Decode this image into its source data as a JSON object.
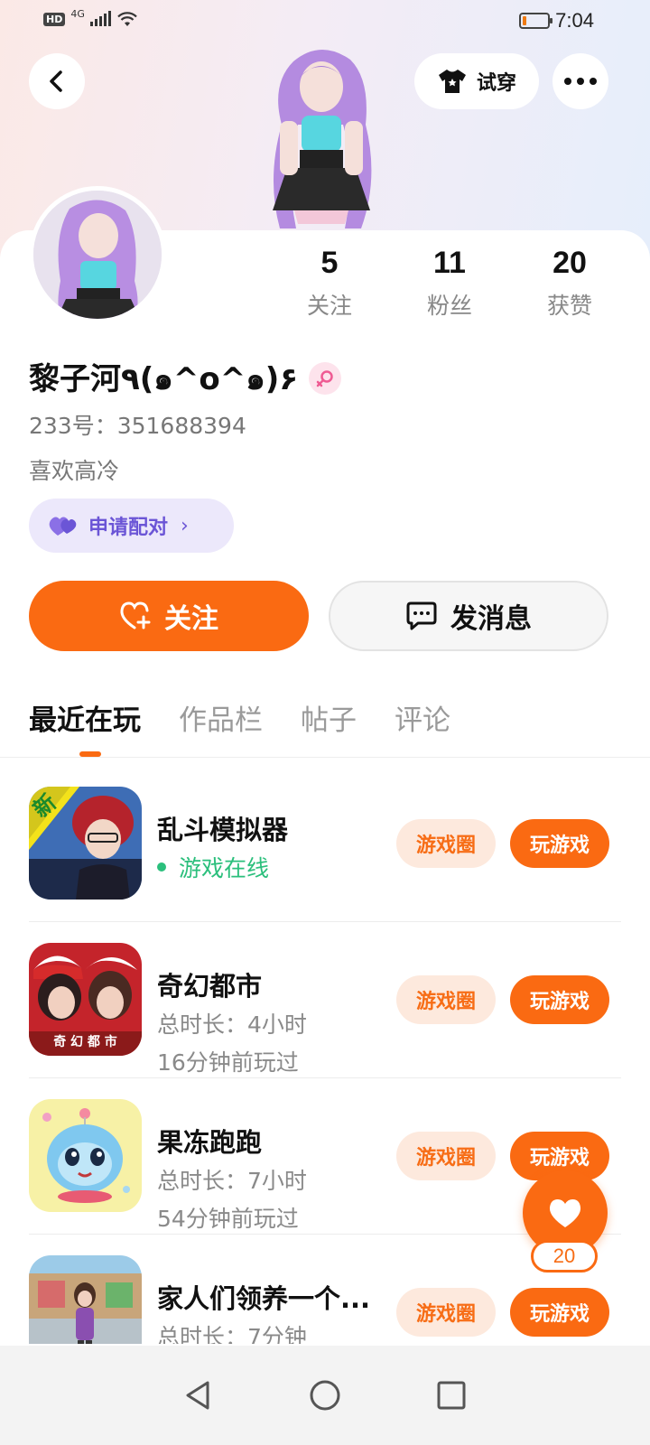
{
  "status_bar": {
    "hd": "HD",
    "network": "4G",
    "time": "7:04",
    "battery_level": 0.15,
    "icons": [
      "signal-icon",
      "wifi-icon",
      "battery-icon"
    ]
  },
  "header": {
    "tryon_label": "试穿",
    "icons": [
      "back-arrow-icon",
      "tshirt-icon",
      "more-dots-icon"
    ]
  },
  "stats": [
    {
      "value": "5",
      "label": "关注"
    },
    {
      "value": "11",
      "label": "粉丝"
    },
    {
      "value": "20",
      "label": "获赞"
    }
  ],
  "profile": {
    "username": "黎子河٩(๑^o^๑)۶",
    "uid": "233号：351688394",
    "bio": "喜欢高冷",
    "pair_label": "申请配对",
    "gender": "female"
  },
  "actions": {
    "follow_label": "关注",
    "message_label": "发消息"
  },
  "tabs": [
    "最近在玩",
    "作品栏",
    "帖子",
    "评论"
  ],
  "games": [
    {
      "name": "乱斗模拟器",
      "status": "游戏在线",
      "circle_label": "游戏圈",
      "play_label": "玩游戏"
    },
    {
      "name": "奇幻都市",
      "duration": "总时长：4小时",
      "last_played": "16分钟前玩过",
      "icon_text": "奇 幻 都 市",
      "circle_label": "游戏圈",
      "play_label": "玩游戏"
    },
    {
      "name": "果冻跑跑",
      "duration": "总时长：7小时",
      "last_played": "54分钟前玩过",
      "circle_label": "游戏圈",
      "play_label": "玩游戏"
    },
    {
      "name": "家人们领养一个...",
      "duration": "总时长：7分钟",
      "circle_label": "游戏圈",
      "play_label": "玩游戏"
    }
  ],
  "game1_badge": "新",
  "floating_like": {
    "count": "20"
  },
  "colors": {
    "accent": "#fa6a12",
    "accent_light": "#fde9dd",
    "pair_purple": "#6b55d6",
    "online_green": "#2bbf7c"
  }
}
